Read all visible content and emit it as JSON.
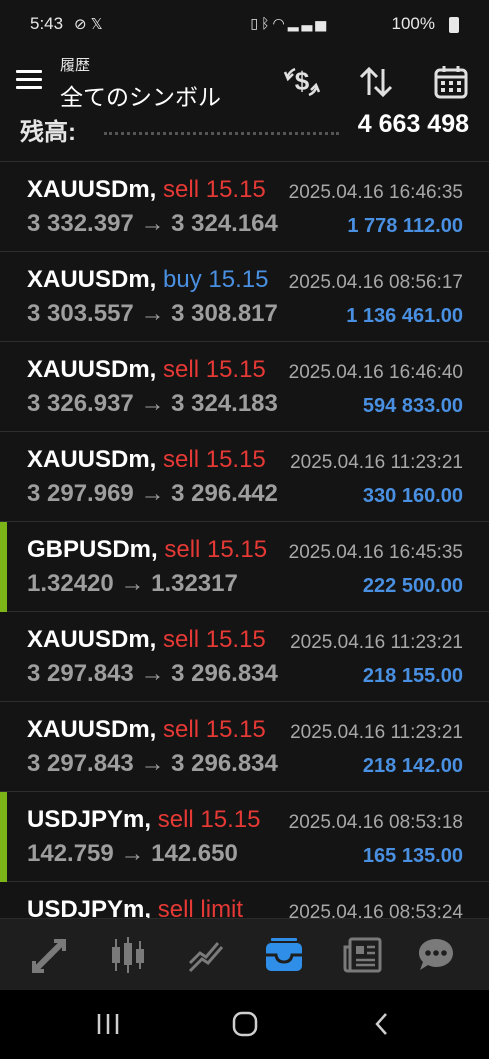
{
  "status_bar": {
    "time": "5:43",
    "left_icons": [
      "check-circle-icon",
      "x-logo-icon"
    ],
    "right_icons": [
      "battery-saver-icon",
      "bluetooth-icon",
      "wifi-icon",
      "signal-icon"
    ],
    "battery_percent": "100%"
  },
  "header": {
    "subtitle": "履歴",
    "title": "全てのシンボル",
    "dollar_label": "$"
  },
  "balance": {
    "label": "残高:",
    "value": "4 663 498"
  },
  "deals": [
    {
      "symbol": "XAUUSDm,",
      "type": "sell",
      "volume": "15.15",
      "time": "2025.04.16 16:46:35",
      "prices": "3 332.397 → 3 324.164",
      "profit": "1 778 112.00",
      "marker": false
    },
    {
      "symbol": "XAUUSDm,",
      "type": "buy",
      "volume": "15.15",
      "time": "2025.04.16 08:56:17",
      "prices": "3 303.557 → 3 308.817",
      "profit": "1 136 461.00",
      "marker": false
    },
    {
      "symbol": "XAUUSDm,",
      "type": "sell",
      "volume": "15.15",
      "time": "2025.04.16 16:46:40",
      "prices": "3 326.937 → 3 324.183",
      "profit": "594 833.00",
      "marker": false
    },
    {
      "symbol": "XAUUSDm,",
      "type": "sell",
      "volume": "15.15",
      "time": "2025.04.16 11:23:21",
      "prices": "3 297.969 → 3 296.442",
      "profit": "330 160.00",
      "marker": false
    },
    {
      "symbol": "GBPUSDm,",
      "type": "sell",
      "volume": "15.15",
      "time": "2025.04.16 16:45:35",
      "prices": "1.32420 → 1.32317",
      "profit": "222 500.00",
      "marker": true
    },
    {
      "symbol": "XAUUSDm,",
      "type": "sell",
      "volume": "15.15",
      "time": "2025.04.16 11:23:21",
      "prices": "3 297.843 → 3 296.834",
      "profit": "218 155.00",
      "marker": false
    },
    {
      "symbol": "XAUUSDm,",
      "type": "sell",
      "volume": "15.15",
      "time": "2025.04.16 11:23:21",
      "prices": "3 297.843 → 3 296.834",
      "profit": "218 142.00",
      "marker": false
    },
    {
      "symbol": "USDJPYm,",
      "type": "sell",
      "volume": "15.15",
      "time": "2025.04.16 08:53:18",
      "prices": "142.759 → 142.650",
      "profit": "165 135.00",
      "marker": true
    },
    {
      "symbol": "USDJPYm,",
      "type": "sell limit",
      "volume": "",
      "time": "2025.04.16 08:53:24",
      "prices": "",
      "profit": "",
      "marker": false
    }
  ],
  "bottom_nav": [
    "quotes-icon",
    "chart-icon",
    "trade-icon",
    "history-icon",
    "news-icon",
    "chat-icon"
  ],
  "colors": {
    "background": "#141414",
    "sell": "#e53935",
    "buy": "#4a90e2",
    "profit": "#4a90e2",
    "active_nav": "#2f8fe8",
    "marker": "#7cb518"
  }
}
